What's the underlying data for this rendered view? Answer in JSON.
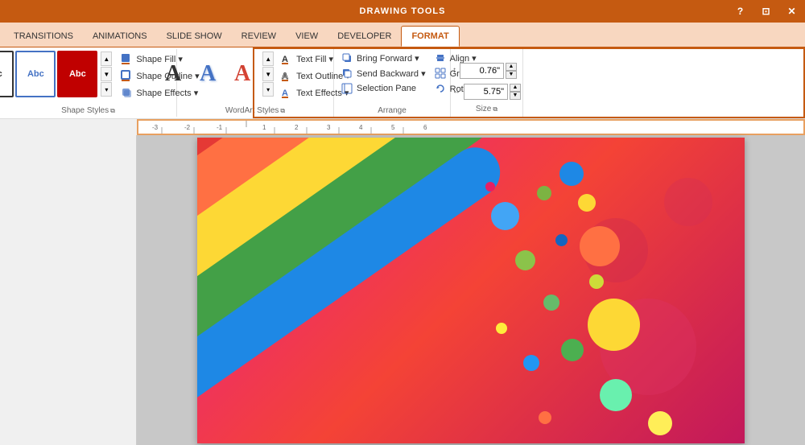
{
  "titleBar": {
    "label": "DRAWING TOOLS",
    "controls": [
      "?",
      "⊡",
      "✕"
    ]
  },
  "tabs": {
    "items": [
      {
        "label": "TRANSITIONS",
        "active": false
      },
      {
        "label": "ANIMATIONS",
        "active": false
      },
      {
        "label": "SLIDE SHOW",
        "active": false
      },
      {
        "label": "REVIEW",
        "active": false
      },
      {
        "label": "VIEW",
        "active": false
      },
      {
        "label": "DEVELOPER",
        "active": false
      },
      {
        "label": "FORMAT",
        "active": true
      }
    ]
  },
  "ribbon": {
    "sections": {
      "shapeStyles": {
        "label": "Shape Styles",
        "options": [
          {
            "label": "Shape Fill ▾",
            "icon": "fill"
          },
          {
            "label": "Shape Outline ▾",
            "icon": "outline"
          },
          {
            "label": "Shape Effects ▾",
            "icon": "effects"
          }
        ]
      },
      "wordArtStyles": {
        "label": "WordArt Styles",
        "options": [
          {
            "label": "Text Fill ▾",
            "icon": "text-fill"
          },
          {
            "label": "Text Outline ▾",
            "icon": "text-outline"
          },
          {
            "label": "Text Effects ▾",
            "icon": "text-effects"
          }
        ]
      },
      "arrange": {
        "label": "Arrange",
        "items": [
          {
            "label": "Bring Forward ▾",
            "icon": "bring-forward"
          },
          {
            "label": "Send Backward ▾",
            "icon": "send-backward"
          },
          {
            "label": "Selection Pane",
            "icon": "selection-pane"
          },
          {
            "label": "Align ▾",
            "icon": "align"
          },
          {
            "label": "Group ▾",
            "icon": "group"
          },
          {
            "label": "Rotate ▾",
            "icon": "rotate"
          }
        ]
      },
      "size": {
        "label": "Size",
        "height": "0.76\"",
        "width": "5.75\""
      }
    }
  }
}
